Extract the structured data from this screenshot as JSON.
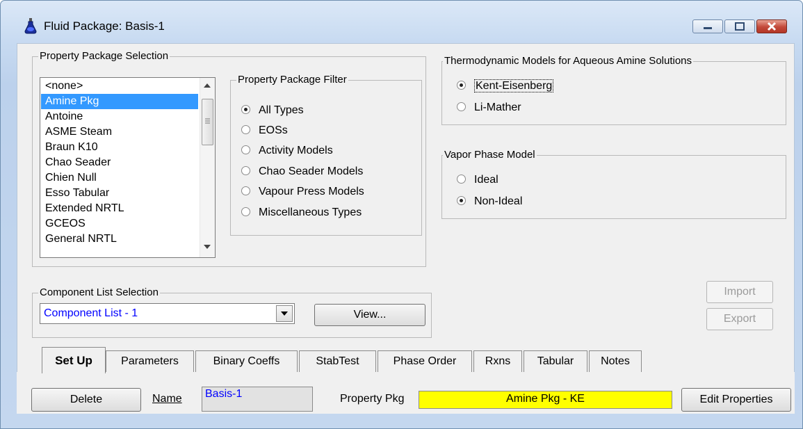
{
  "window": {
    "title": "Fluid Package: Basis-1",
    "icon": "flask-icon",
    "controls": [
      "minimize-icon",
      "maximize-icon",
      "close-icon"
    ]
  },
  "property_package_selection": {
    "title": "Property Package Selection",
    "items": [
      "<none>",
      "Amine Pkg",
      "Antoine",
      "ASME Steam",
      "Braun K10",
      "Chao Seader",
      "Chien Null",
      "Esso Tabular",
      "Extended NRTL",
      "GCEOS",
      "General NRTL"
    ],
    "selected": "Amine Pkg"
  },
  "property_package_filter": {
    "title": "Property Package Filter",
    "options": [
      "All Types",
      "EOSs",
      "Activity Models",
      "Chao Seader Models",
      "Vapour Press Models",
      "Miscellaneous Types"
    ],
    "selected": "All Types"
  },
  "thermo_models": {
    "title": "Thermodynamic Models for Aqueous Amine Solutions",
    "options": [
      "Kent-Eisenberg",
      "Li-Mather"
    ],
    "selected": "Kent-Eisenberg"
  },
  "vapor_phase": {
    "title": "Vapor Phase Model",
    "options": [
      "Ideal",
      "Non-Ideal"
    ],
    "selected": "Non-Ideal"
  },
  "component_list": {
    "title": "Component List Selection",
    "value": "Component List - 1",
    "view_label": "View..."
  },
  "import_label": "Import",
  "export_label": "Export",
  "tabs": [
    "Set Up",
    "Parameters",
    "Binary Coeffs",
    "StabTest",
    "Phase Order",
    "Rxns",
    "Tabular",
    "Notes"
  ],
  "active_tab": "Set Up",
  "bottom": {
    "delete_label": "Delete",
    "name_label": "Name",
    "name_value": "Basis-1",
    "property_pkg_label": "Property Pkg",
    "property_pkg_value": "Amine Pkg - KE",
    "edit_label": "Edit Properties",
    "property_pkg_color": "#ffff00"
  }
}
